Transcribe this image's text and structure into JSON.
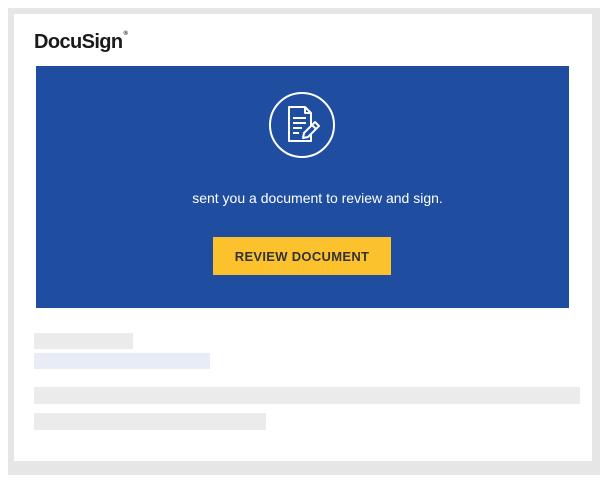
{
  "brand": {
    "name": "DocuSign",
    "trademark": "®"
  },
  "hero": {
    "icon": "document-sign-icon",
    "message": "sent you a document to review and sign.",
    "button_label": "REVIEW DOCUMENT"
  },
  "colors": {
    "hero_background": "#1f4da0",
    "button_background": "#fcc22d",
    "button_text": "#333333",
    "frame": "#e6e6e6"
  },
  "placeholders": [
    "sender-name-placeholder",
    "sender-email-placeholder",
    "body-line-placeholder",
    "body-line-placeholder"
  ]
}
